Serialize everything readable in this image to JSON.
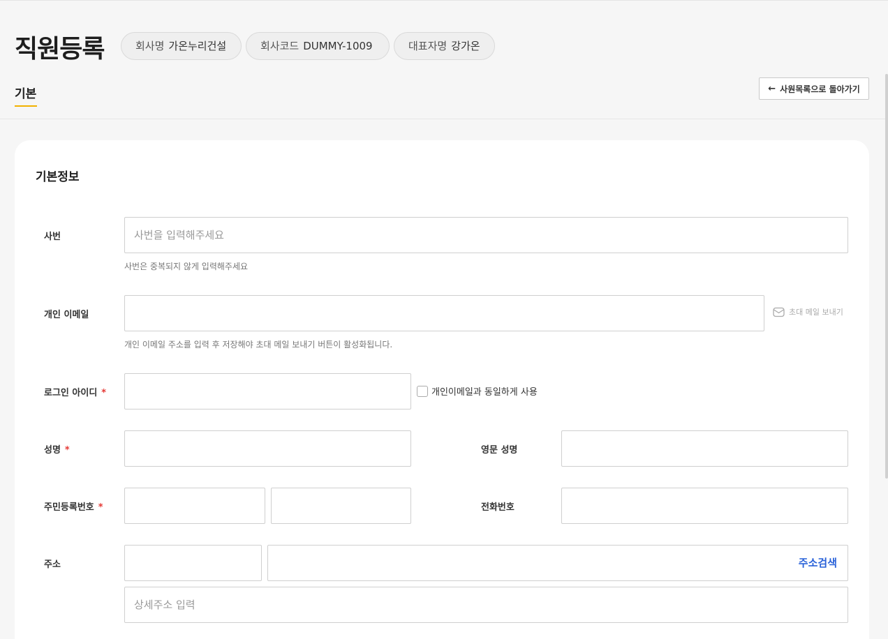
{
  "page": {
    "title": "직원등록",
    "chips": [
      {
        "key": "회사명",
        "value": "가온누리건설"
      },
      {
        "key": "회사코드",
        "value": "DUMMY-1009"
      },
      {
        "key": "대표자명",
        "value": "강가온"
      }
    ],
    "tab": "기본",
    "back_button": "사원목록으로 돌아가기"
  },
  "form": {
    "section_title": "기본정보",
    "employee_no": {
      "label": "사번",
      "placeholder": "사번을 입력해주세요",
      "hint": "사번은 중복되지 않게 입력해주세요"
    },
    "personal_email": {
      "label": "개인 이메일",
      "value": "",
      "send_invite": "초대 메일 보내기",
      "hint": "개인 이메일 주소를 입력 후 저장해야 초대 메일 보내기 버튼이 활성화됩니다."
    },
    "login_id": {
      "label": "로그인 아이디",
      "required": "*",
      "value": "",
      "same_as_email": "개인이메일과 동일하게 사용"
    },
    "name": {
      "label": "성명",
      "required": "*",
      "value": ""
    },
    "english_name": {
      "label": "영문 성명",
      "value": ""
    },
    "resident_no": {
      "label": "주민등록번호",
      "required": "*",
      "front": "",
      "back": ""
    },
    "phone": {
      "label": "전화번호",
      "value": ""
    },
    "address": {
      "label": "주소",
      "zipcode": "",
      "road": "",
      "search": "주소검색",
      "detail_placeholder": "상세주소 입력"
    }
  },
  "colors": {
    "accent_underline": "#f2b100",
    "required": "#e53935",
    "link": "#2a62d9"
  }
}
